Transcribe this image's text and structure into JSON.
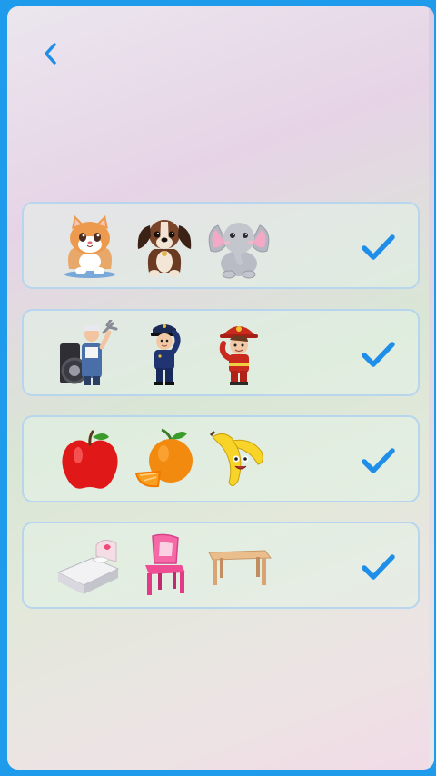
{
  "header": {
    "back_icon": "chevron-left-icon",
    "accent": "#1f8ee8"
  },
  "rows": [
    {
      "group": "animals",
      "items": [
        "cat-icon",
        "dog-icon",
        "elephant-icon"
      ],
      "check_icon": "checkmark-icon"
    },
    {
      "group": "jobs",
      "items": [
        "mechanic-icon",
        "police-officer-icon",
        "firefighter-icon"
      ],
      "check_icon": "checkmark-icon"
    },
    {
      "group": "fruits",
      "items": [
        "apple-icon",
        "orange-icon",
        "banana-icon"
      ],
      "check_icon": "checkmark-icon"
    },
    {
      "group": "furniture",
      "items": [
        "bed-icon",
        "chair-icon",
        "table-icon"
      ],
      "check_icon": "checkmark-icon"
    }
  ]
}
